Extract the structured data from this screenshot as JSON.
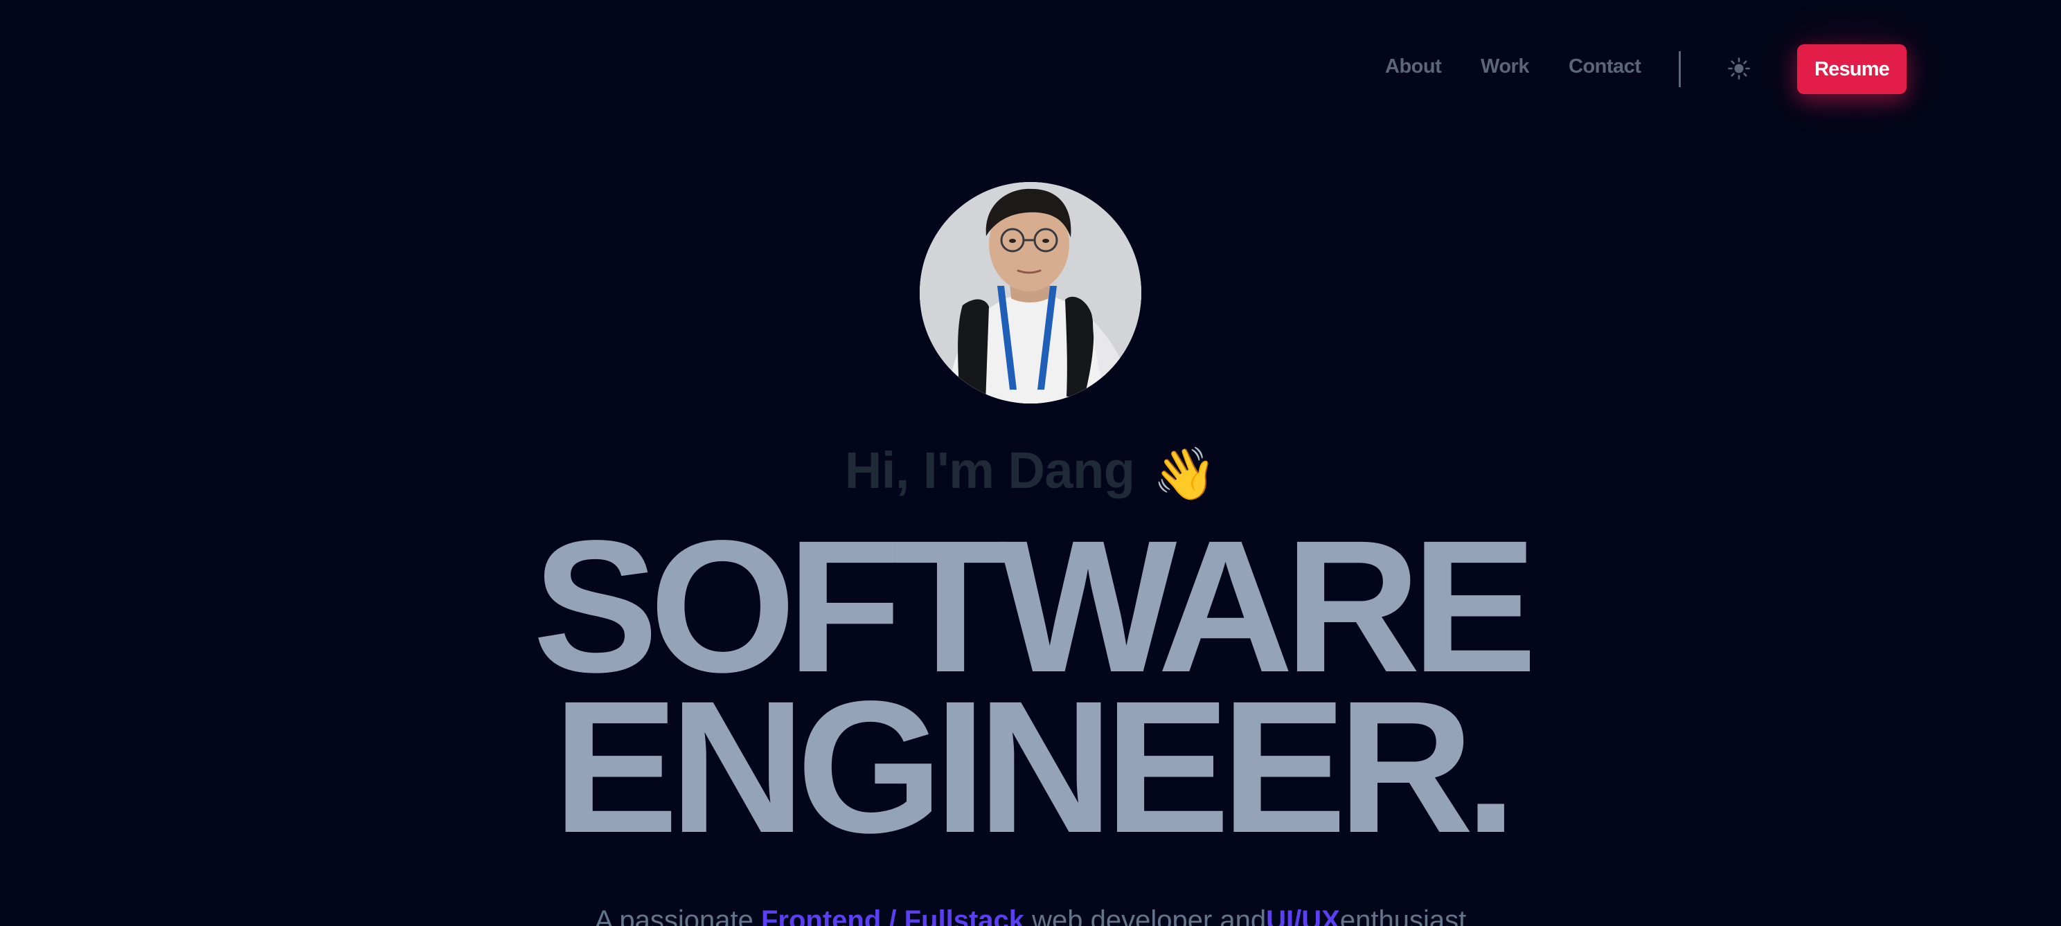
{
  "nav": {
    "links": [
      {
        "label": "About"
      },
      {
        "label": "Work"
      },
      {
        "label": "Contact"
      }
    ],
    "theme_toggle_icon": "sun-icon",
    "resume_label": "Resume",
    "accent_color": "#e11d48"
  },
  "hero": {
    "avatar_icon": "profile-photo",
    "greeting": "Hi, I'm Dang",
    "greeting_emoji": "👋",
    "headline_line1": "SOFTWARE",
    "headline_line2": "ENGINEER.",
    "tagline": {
      "part1": "A passionate ",
      "highlight1": "Frontend / Fullstack",
      "part2": " web developer and",
      "highlight2": "UI/UX",
      "part3": "enthusiast"
    }
  },
  "colors": {
    "background": "#03061a",
    "headline": "#94a3b8",
    "highlight": "#5b3ff0"
  }
}
